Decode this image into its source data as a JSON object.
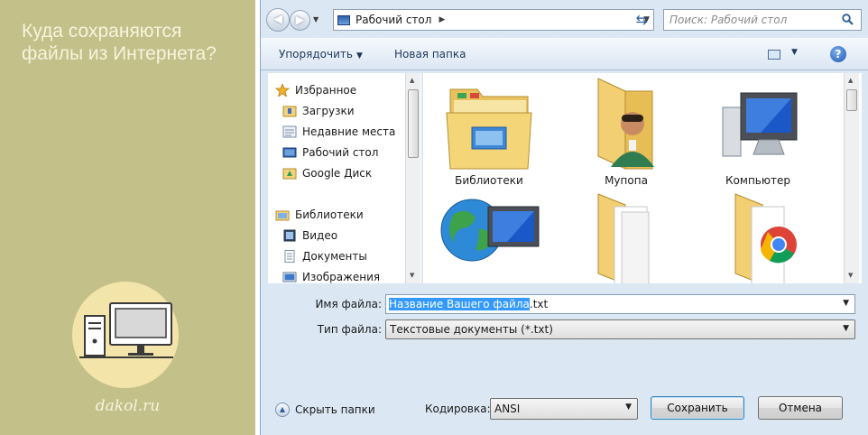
{
  "banner": {
    "title": "Куда сохраняются файлы из Интернета?",
    "site": "dakol.ru"
  },
  "window": {
    "address": {
      "location": "Рабочий стол"
    },
    "search": {
      "placeholder": "Поиск: Рабочий стол"
    },
    "toolbar": {
      "organize_label": "Упорядочить",
      "new_folder_label": "Новая папка"
    },
    "nav_pane": {
      "items": [
        {
          "label": "Избранное",
          "icon": "star-icon",
          "group": true
        },
        {
          "label": "Загрузки",
          "icon": "downloads-icon",
          "group": false
        },
        {
          "label": "Недавние места",
          "icon": "recent-places-icon",
          "group": false
        },
        {
          "label": "Рабочий стол",
          "icon": "desktop-icon",
          "group": false
        },
        {
          "label": "Google Диск",
          "icon": "google-drive-icon",
          "group": false
        },
        {
          "label": "Библиотеки",
          "icon": "libraries-icon",
          "group": true
        },
        {
          "label": "Видео",
          "icon": "video-icon",
          "group": false
        },
        {
          "label": "Документы",
          "icon": "documents-icon",
          "group": false
        },
        {
          "label": "Изображения",
          "icon": "images-icon",
          "group": false
        }
      ]
    },
    "files": [
      {
        "label": "Библиотеки",
        "icon": "libraries-folder-icon"
      },
      {
        "label": "Мупопа",
        "icon": "user-folder-icon"
      },
      {
        "label": "Компьютер",
        "icon": "computer-icon"
      },
      {
        "label": "",
        "icon": "network-globe-icon"
      },
      {
        "label": "",
        "icon": "folder-icon"
      },
      {
        "label": "",
        "icon": "chrome-folder-icon"
      }
    ],
    "form": {
      "filename_label": "Имя файла:",
      "filename_selected": "Название Вашего файла",
      "filename_suffix": ".txt",
      "filetype_label": "Тип файла:",
      "filetype_value": "Текстовые документы (*.txt)",
      "encoding_label": "Кодировка:",
      "encoding_value": "ANSI"
    },
    "footer": {
      "hide_folders_label": "Скрыть папки",
      "save_label": "Сохранить",
      "cancel_label": "Отмена"
    }
  },
  "colors": {
    "banner_bg": "#c3c089",
    "banner_text": "#f6f4de",
    "dialog_bg": "#dbe7f3",
    "selection": "#3399ff"
  }
}
